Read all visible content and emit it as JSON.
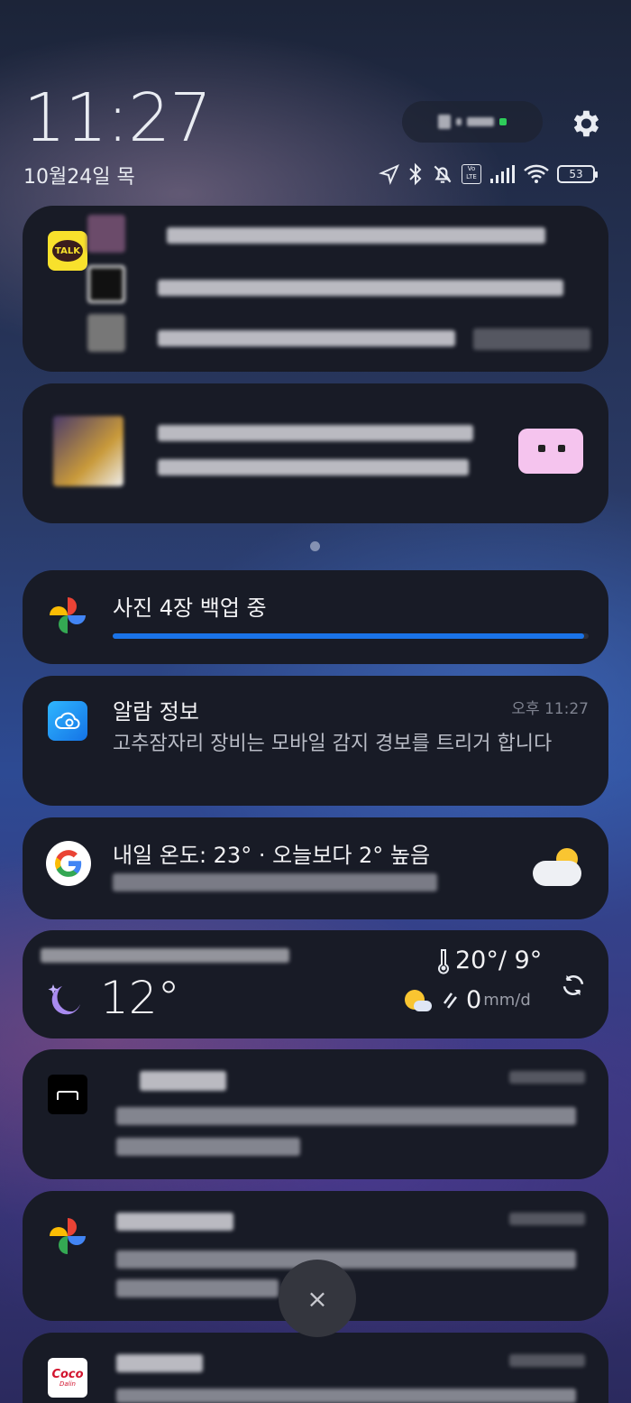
{
  "status_bar": {
    "time": "11:27",
    "date": "10월24일 목",
    "battery": "53",
    "icons": [
      "location-icon",
      "bluetooth-icon",
      "mute-icon",
      "volte-icon",
      "signal-icon",
      "wifi-icon",
      "battery-icon"
    ]
  },
  "quick": {
    "settings_icon": "gear-icon"
  },
  "notifications": [
    {
      "app": "KakaoTalk",
      "icon": "talk-icon",
      "icon_text": "TALK"
    },
    {
      "app": "Chat",
      "icon": "sticker-icon"
    },
    {
      "app": "Google Photos",
      "icon": "pinwheel-icon",
      "title": "사진 4장 백업 중",
      "progress": 0.99
    },
    {
      "app": "Alarm",
      "icon": "camera-cloud-icon",
      "title": "알람 정보",
      "time": "오후 11:27",
      "body": "고추잠자리 장비는 모바일 감지 경보를 트리거 합니다"
    },
    {
      "app": "Google",
      "icon": "google-icon",
      "title": "내일 온도: 23° · 오늘보다 2° 높음",
      "weather_icon": "partly-cloudy-icon"
    },
    {
      "app": "Weather",
      "icon": "moon-icon",
      "current_temp": "12°",
      "high_low": "20°/ 9°",
      "precip_value": "0",
      "precip_unit": "mm/d",
      "refresh_icon": "refresh-icon"
    },
    {
      "app": "Unknown",
      "icon": "box-icon"
    },
    {
      "app": "Google Photos",
      "icon": "pinwheel-icon"
    },
    {
      "app": "Coco Dalin",
      "icon": "coco-icon",
      "icon_text": "Coco",
      "icon_sub": "Dalin"
    }
  ],
  "clear_button": {
    "label": "×"
  },
  "colors": {
    "accent": "#1a73e8",
    "card": "#181b26",
    "talk": "#f8e12c"
  }
}
